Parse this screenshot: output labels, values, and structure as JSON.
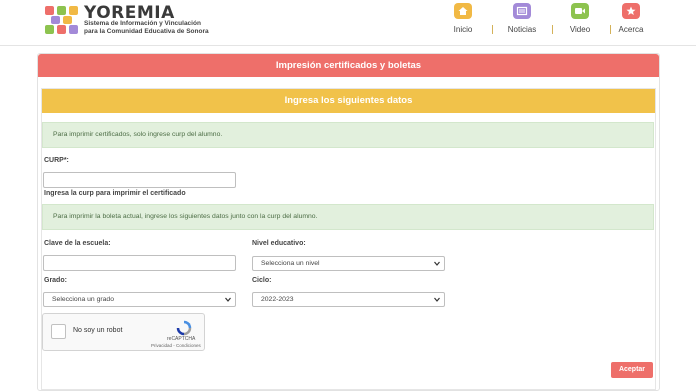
{
  "brand": {
    "name": "YOREMIA",
    "subtitle_line1": "Sistema de Información y Vinculación",
    "subtitle_line2": "para la Comunidad Educativa de Sonora"
  },
  "nav": [
    {
      "label": "Inicio",
      "icon": "home-icon",
      "color": "#f1b945"
    },
    {
      "label": "Noticias",
      "icon": "news-icon",
      "color": "#a38ad8"
    },
    {
      "label": "Video",
      "icon": "video-icon",
      "color": "#8dc34f"
    },
    {
      "label": "Acerca",
      "icon": "star-icon",
      "color": "#ee6f6a"
    }
  ],
  "page": {
    "title": "Impresión certificados y boletas",
    "section_title": "Ingresa los siguientes datos"
  },
  "form": {
    "alert_certificate": "Para imprimir certificados, solo ingrese curp del alumno.",
    "curp_label": "CURP*:",
    "curp_value": "",
    "curp_help": "Ingresa la curp para imprimir el certificado",
    "alert_report": "Para imprimir la boleta actual, ingrese los siguientes datos junto con la curp del alumno.",
    "school_key_label": "Clave de la escuela:",
    "school_key_value": "",
    "level_label": "Nivel educativo:",
    "level_selected": "Selecciona un nivel",
    "grade_label": "Grado:",
    "grade_selected": "Selecciona un grado",
    "cycle_label": "Ciclo:",
    "cycle_selected": "2022-2023",
    "submit_label": "Aceptar"
  },
  "captcha": {
    "label": "No soy un robot",
    "brand": "reCAPTCHA",
    "links": "Privacidad - Condiciones"
  },
  "colors": {
    "accent_red": "#ee6f6a",
    "accent_yellow": "#f1c24a",
    "alert_green": "#e2f0dd"
  }
}
